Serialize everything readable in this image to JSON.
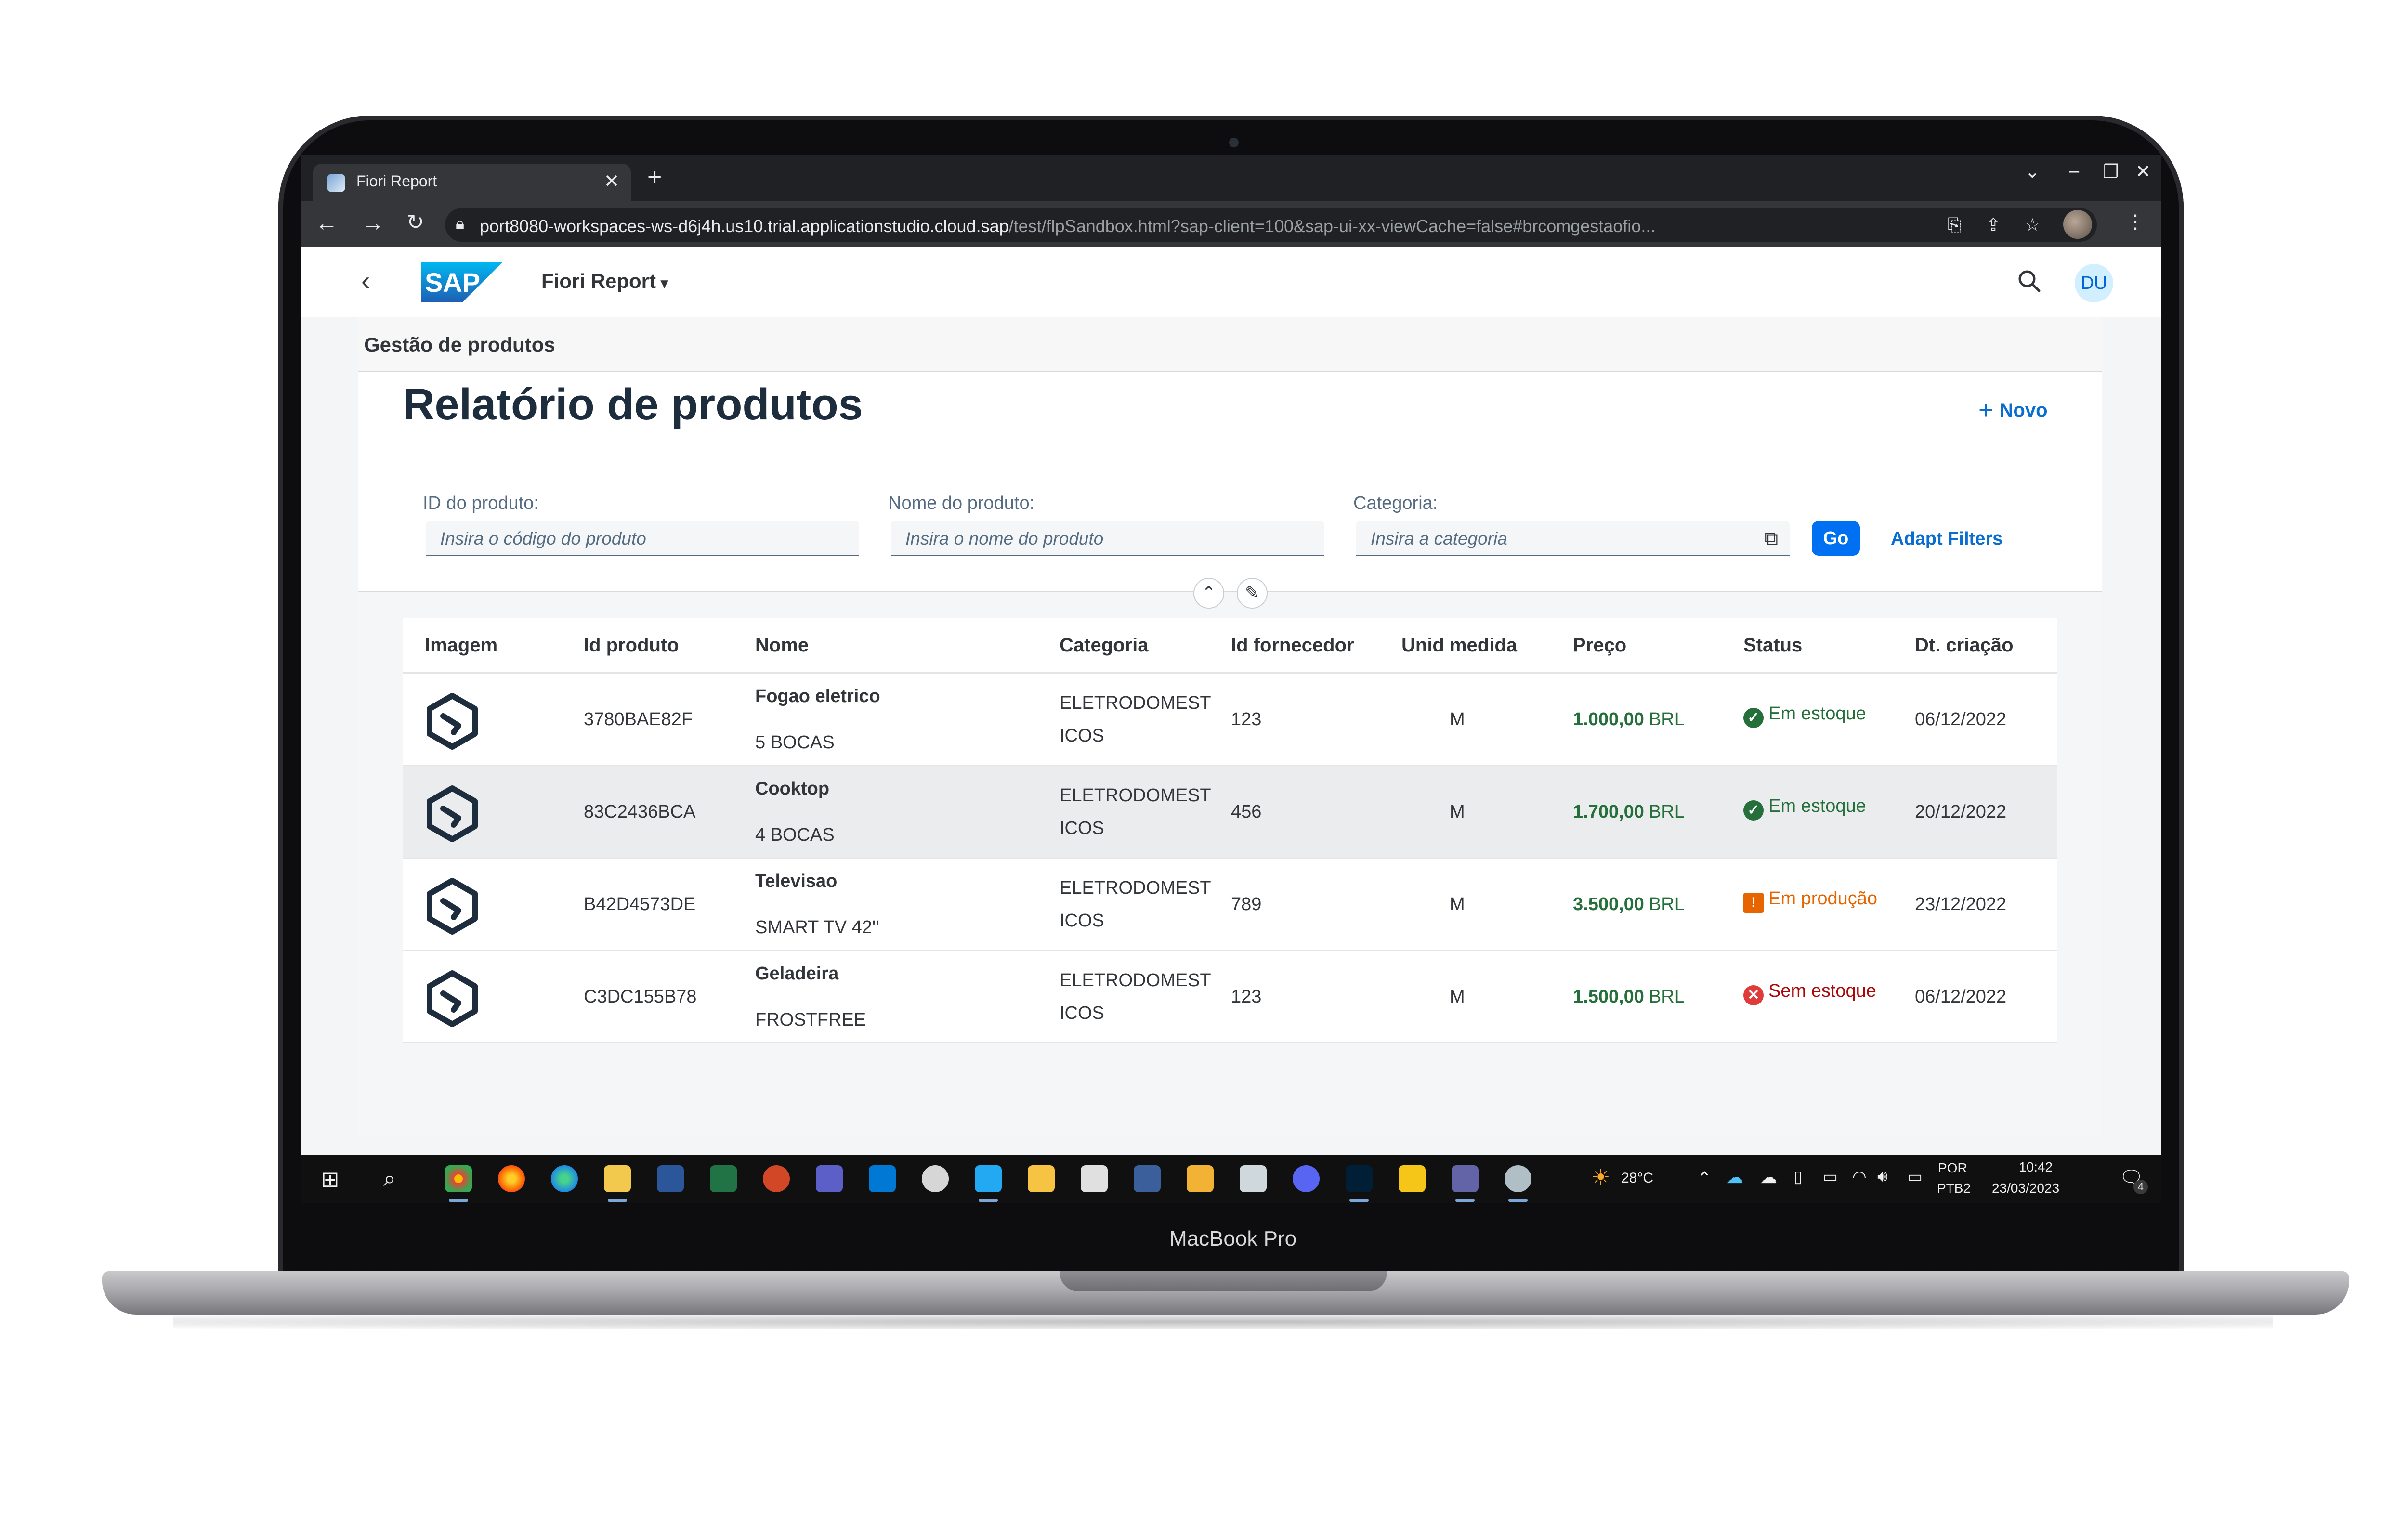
{
  "device": {
    "label": "MacBook Pro"
  },
  "browser": {
    "tab_title": "Fiori Report",
    "tab_close": "✕",
    "new_tab": "+",
    "url_host": "port8080-workspaces-ws-d6j4h.us10.trial.applicationstudio.cloud.sap",
    "url_path": "/test/flpSandbox.html?sap-client=100&sap-ui-xx-viewCache=false#brcomgestaofio..."
  },
  "shell": {
    "app_title": "Fiori Report",
    "logo_text": "SAP",
    "avatar_initials": "DU"
  },
  "page": {
    "breadcrumb": "Gestão de produtos",
    "title": "Relatório de produtos",
    "new_button": "Novo",
    "filters": {
      "product_id": {
        "label": "ID do produto:",
        "placeholder": "Insira o código do produto"
      },
      "product_name": {
        "label": "Nome do produto:",
        "placeholder": "Insira o nome do produto"
      },
      "category": {
        "label": "Categoria:",
        "placeholder": "Insira a categoria"
      },
      "go_button": "Go",
      "adapt_button": "Adapt Filters"
    }
  },
  "table": {
    "columns": [
      "Imagem",
      "Id produto",
      "Nome",
      "Categoria",
      "Id fornecedor",
      "Unid medida",
      "Preço",
      "Status",
      "Dt. criação"
    ],
    "rows": [
      {
        "id": "3780BAE82F",
        "name": "Fogao eletrico",
        "description": "5 BOCAS",
        "category_l1": "ELETRODOMEST",
        "category_l2": "ICOS",
        "supplier": "123",
        "unit": "M",
        "price": "1.000,00",
        "currency": "BRL",
        "status": "Em estoque",
        "status_type": "success",
        "date": "06/12/2022"
      },
      {
        "id": "83C2436BCA",
        "name": "Cooktop",
        "description": "4 BOCAS",
        "category_l1": "ELETRODOMEST",
        "category_l2": "ICOS",
        "supplier": "456",
        "unit": "M",
        "price": "1.700,00",
        "currency": "BRL",
        "status": "Em estoque",
        "status_type": "success",
        "date": "20/12/2022"
      },
      {
        "id": "B42D4573DE",
        "name": "Televisao",
        "description": "SMART TV 42''",
        "category_l1": "ELETRODOMEST",
        "category_l2": "ICOS",
        "supplier": "789",
        "unit": "M",
        "price": "3.500,00",
        "currency": "BRL",
        "status": "Em produção",
        "status_type": "warning",
        "date": "23/12/2022"
      },
      {
        "id": "C3DC155B78",
        "name": "Geladeira",
        "description": "FROSTFREE",
        "category_l1": "ELETRODOMEST",
        "category_l2": "ICOS",
        "supplier": "123",
        "unit": "M",
        "price": "1.500,00",
        "currency": "BRL",
        "status": "Sem estoque",
        "status_type": "error",
        "date": "06/12/2022"
      }
    ]
  },
  "taskbar": {
    "weather": "28°C",
    "language_1": "POR",
    "language_2": "PTB2",
    "time": "10:42",
    "date": "23/03/2023",
    "notifications": "4"
  },
  "colors": {
    "success": "#256f3a",
    "warning": "#e76500",
    "error": "#aa0808",
    "accent": "#0070f2"
  }
}
